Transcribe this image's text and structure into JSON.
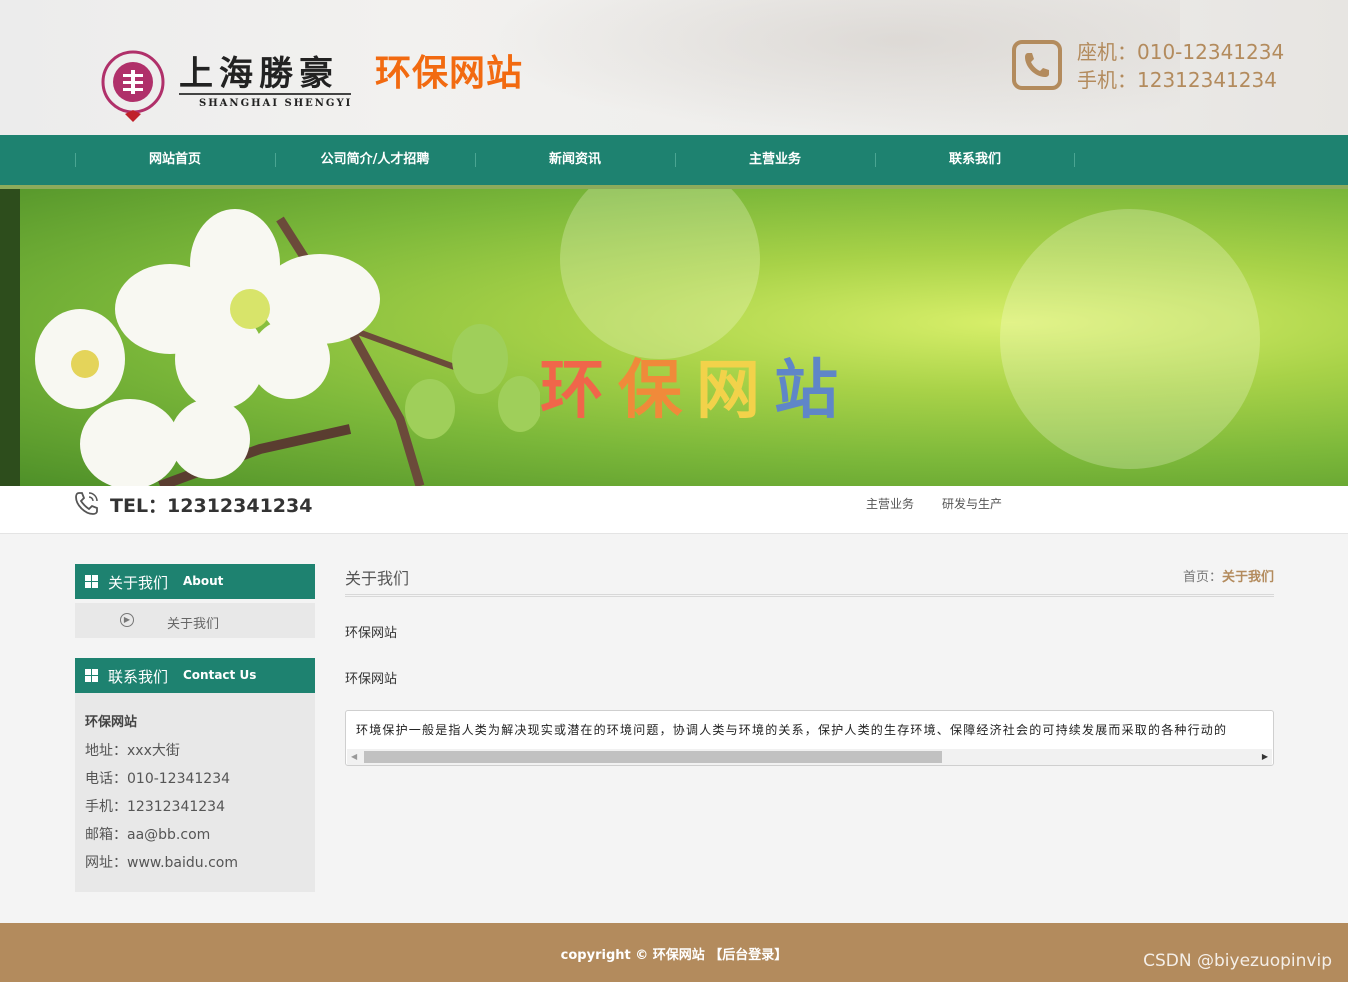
{
  "header": {
    "logo_script": "上海勝豪",
    "logo_en": "SHANGHAI  SHENGYI",
    "site_title": "环保网站",
    "landline": "座机：010-12341234",
    "mobile": "手机：12312341234"
  },
  "nav": {
    "items": [
      {
        "label": "网站首页"
      },
      {
        "label": "公司简介/人才招聘"
      },
      {
        "label": "新闻资讯"
      },
      {
        "label": "主营业务"
      },
      {
        "label": "联系我们"
      }
    ]
  },
  "banner": {
    "chars": [
      "环",
      "保",
      "网",
      "站"
    ]
  },
  "infobar": {
    "tel": "TEL：12312341234",
    "links": [
      "主营业务",
      "研发与生产"
    ]
  },
  "sidebar": {
    "about": {
      "title_zh": "关于我们",
      "title_en": "About",
      "items": [
        "关于我们"
      ]
    },
    "contact": {
      "title_zh": "联系我们",
      "title_en": "Contact Us",
      "name": "环保网站",
      "address": "地址：xxx大街",
      "phone": "电话：010-12341234",
      "mobile": "手机：12312341234",
      "email": "邮箱：aa@bb.com",
      "website": "网址：www.baidu.com"
    }
  },
  "main": {
    "title": "关于我们",
    "breadcrumb_home": "首页：",
    "breadcrumb_current": "关于我们",
    "para1": "环保网站",
    "para2": "环保网站",
    "scroll_text": "环境保护一般是指人类为解决现实或潜在的环境问题，协调人类与环境的关系，保护人类的生存环境、保障经济社会的可持续发展而采取的各种行动的"
  },
  "footer": {
    "copyright": "copyright © 环保网站 【后台登录】",
    "watermark": "CSDN @biyezuopinvip"
  },
  "colors": {
    "nav_green": "#1e8270",
    "accent_orange": "#f26a10",
    "bronze": "#b38b5d"
  }
}
